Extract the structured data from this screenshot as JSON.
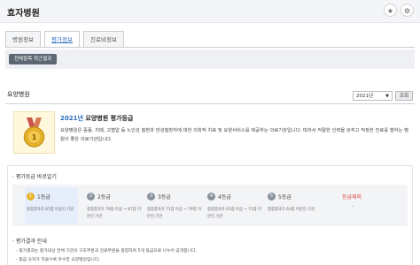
{
  "header": {
    "title": "효자병원",
    "star_icon": "★",
    "gear_icon": "⚙"
  },
  "tabs": [
    {
      "label": "병원정보",
      "active": false
    },
    {
      "label": "평가정보",
      "active": true
    },
    {
      "label": "진료비정보",
      "active": false
    }
  ],
  "subtab": {
    "label": "전체항목 최근결과"
  },
  "section": {
    "title": "요양병원"
  },
  "year_select": {
    "value": "2021년",
    "caret": "▼"
  },
  "view_button": {
    "label": "조회"
  },
  "grade_summary": {
    "year": "2021년",
    "title_rest": " 요양병원 평가등급",
    "description": "요양병원은 중풍, 치매, 고혈압 등 노인성 질환과 만성질환자에 대한 의학적 치료 및 요양서비스를 제공하는 의료기관입니다. 따라서 적절한 인력을 갖추고 적정한 진료를 행하는 병원이 좋은 의료기관입니다."
  },
  "grade_panel": {
    "title": "· 평가등급 바로알기",
    "grades": [
      {
        "num": "1",
        "name": "1등급",
        "desc": "종합결과가 87점 이상인 기관",
        "active": true
      },
      {
        "num": "2",
        "name": "2등급",
        "desc": "종합결과가 79점 이상 ~ 87점 미만인 기관",
        "active": false
      },
      {
        "num": "3",
        "name": "3등급",
        "desc": "종합결과가 71점 이상 ~ 79점 미만인 기관",
        "active": false
      },
      {
        "num": "4",
        "name": "4등급",
        "desc": "종합결과가 63점 이상 ~ 71점 미만인 기관",
        "active": false
      },
      {
        "num": "5",
        "name": "5등급",
        "desc": "종합결과가 63점 미만인 기관",
        "active": false
      }
    ],
    "excluded": {
      "label": "등급제외",
      "value": "-"
    }
  },
  "guide": {
    "title": "· 평가결과 안내",
    "lines": [
      "- 평가결과는 평가대상 전체 기관의 구조부문과 진료부문을 종합하여 5개 등급으로 나누어 공개합니다.",
      "- 등급 숫자가 작을수록 우수한 요양병원입니다."
    ]
  },
  "colors": {
    "accent": "#2a6cc0",
    "gold": "#e8b52a",
    "excluded_red": "#e0433b"
  }
}
